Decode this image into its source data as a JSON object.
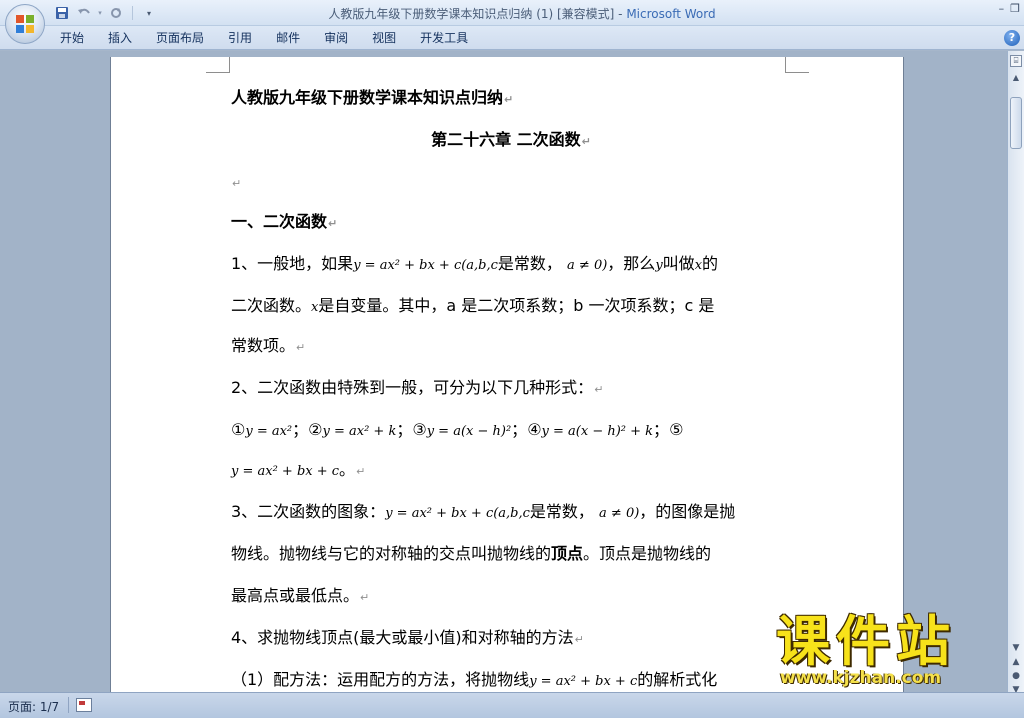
{
  "window": {
    "title_doc": "人教版九年级下册数学课本知识点归纳 (1) [兼容模式] - ",
    "title_app": "Microsoft Word",
    "minimize": "–",
    "restore": "❐"
  },
  "qat": {
    "save_icon": "save-icon",
    "undo_icon": "undo-icon",
    "redo_icon": "redo-icon"
  },
  "ribbon": {
    "tabs": [
      "开始",
      "插入",
      "页面布局",
      "引用",
      "邮件",
      "审阅",
      "视图",
      "开发工具"
    ],
    "help": "?"
  },
  "document": {
    "doc_title": "人教版九年级下册数学课本知识点归纳",
    "chapter": "第二十六章  二次函数",
    "section1": "一、二次函数",
    "p1_a": "1、一般地，如果",
    "p1_math": "y = ax² + bx + c(a,b,c",
    "p1_b": "是常数，",
    "p1_math2": "a ≠ 0)",
    "p1_c": "，那么",
    "p1_y": "y",
    "p1_d": "叫做",
    "p1_x": "x",
    "p1_e": "的",
    "p1_line2_a": "二次函数。",
    "p1_line2_x": "x",
    "p1_line2_b": "是自变量。其中，a 是二次项系数；b 一次项系数；c 是",
    "p1_line3": "常数项。",
    "p2": "2、二次函数由特殊到一般，可分为以下几种形式：",
    "forms": {
      "c1": "①",
      "f1": "y = ax²",
      "c2": "②",
      "f2": "y = ax² + k",
      "c3": "③",
      "f3": "y = a(x − h)²",
      "c4": "④",
      "f4": "y = a(x − h)² + k",
      "c5": "⑤",
      "f5": "y = ax² + bx + c",
      "period": "。",
      "sep": "；"
    },
    "p3_a": "3、二次函数的图象：",
    "p3_math": "y = ax² + bx + c(a,b,c",
    "p3_b": "是常数，",
    "p3_math2": "a ≠ 0)",
    "p3_c": "，的图像是抛",
    "p3_line2_a": "物线。抛物线与它的对称轴的交点叫抛物线的",
    "p3_line2_bold": "顶点",
    "p3_line2_b": "。顶点是抛物线的",
    "p3_line3": "最高点或最低点。",
    "p4": "4、求抛物线顶点(最大或最小值)和对称轴的方法",
    "p5_a": "（1）配方法：运用配方的方法，将抛物线",
    "p5_math": "y = ax² + bx + c",
    "p5_b": "的解析式化",
    "para_mark": "↵"
  },
  "statusbar": {
    "page": "页面: 1/7"
  },
  "watermark": {
    "big": "课件站",
    "url": "www.kjzhan.com"
  }
}
